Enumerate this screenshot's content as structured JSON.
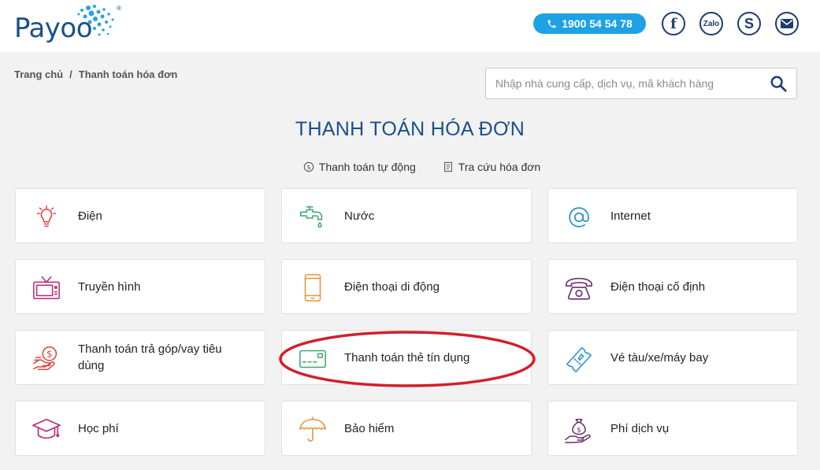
{
  "header": {
    "logo_text": "Payoo",
    "logo_reg": "®",
    "hotline": "1900 54 54 78",
    "social": {
      "facebook": "f",
      "zalo": "Zalo",
      "skype": "S"
    }
  },
  "breadcrumb": {
    "home": "Trang chủ",
    "separator": "/",
    "current": "Thanh toán hóa đơn"
  },
  "search": {
    "placeholder": "Nhập nhà cung cấp, dịch vụ, mã khách hàng",
    "value": ""
  },
  "page_title": "THANH TOÁN HÓA ĐƠN",
  "sub_links": {
    "auto_pay": "Thanh toán tự động",
    "lookup": "Tra cứu hóa đơn"
  },
  "services": [
    {
      "label": "Điện",
      "icon": "lightbulb-icon",
      "color": "#d9463e"
    },
    {
      "label": "Nước",
      "icon": "water-tap-icon",
      "color": "#3aa86b"
    },
    {
      "label": "Internet",
      "icon": "at-sign-icon",
      "color": "#2a8fc9"
    },
    {
      "label": "Truyền hình",
      "icon": "tv-icon",
      "color": "#b5287a"
    },
    {
      "label": "Điện thoại di động",
      "icon": "mobile-phone-icon",
      "color": "#e0953a"
    },
    {
      "label": "Điện thoại cố định",
      "icon": "landline-phone-icon",
      "color": "#6b2f6e"
    },
    {
      "label": "Thanh toán trả góp/vay tiêu dùng",
      "icon": "loan-coin-hand-icon",
      "color": "#d9463e"
    },
    {
      "label": "Thanh toán thẻ tín dụng",
      "icon": "credit-card-icon",
      "color": "#3aa86b"
    },
    {
      "label": "Vé tàu/xe/máy bay",
      "icon": "ticket-icon",
      "color": "#2a8fc9"
    },
    {
      "label": "Học phí",
      "icon": "graduation-cap-icon",
      "color": "#b5287a"
    },
    {
      "label": "Bảo hiểm",
      "icon": "umbrella-icon",
      "color": "#e0953a"
    },
    {
      "label": "Phí dịch vụ",
      "icon": "money-bag-hand-icon",
      "color": "#6b2f6e"
    }
  ],
  "colors": {
    "brand": "#1b4f8a",
    "hotline_bg": "#1fa2e5",
    "highlight_ellipse": "#d11f2a"
  }
}
